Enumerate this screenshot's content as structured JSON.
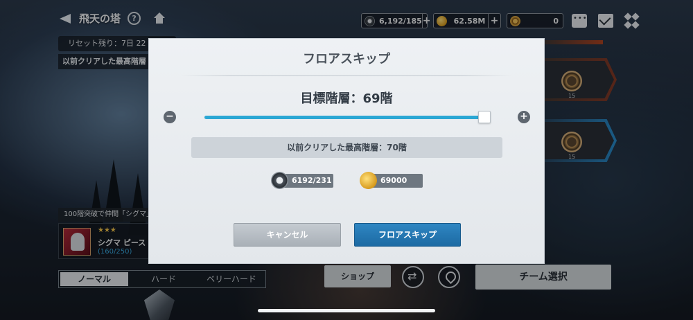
{
  "header": {
    "title": "飛天の塔",
    "help_glyph": "?"
  },
  "resources": {
    "stamina": {
      "icon": "gear-emblem-icon",
      "value": "6,192/185",
      "plus": "+"
    },
    "gold": {
      "icon": "gold-coin-icon",
      "value": "62.58M",
      "plus": "+"
    },
    "ticket": {
      "icon": "ticket-coin-icon",
      "value": "0"
    }
  },
  "left_panel": {
    "reset_text": "リセット残り：7日 22",
    "previous_clear_text": "以前クリアした最高階層",
    "companion_note": "100階突破で仲間「シグマ」",
    "character": {
      "stars": "★★★",
      "name": "シグマ ピース",
      "progress": "(160/250)"
    },
    "mode_tabs": [
      "ノーマル",
      "ハード",
      "ベリーハード"
    ]
  },
  "floor_list": {
    "items": [
      {
        "number": "15"
      },
      {
        "number": "15"
      }
    ]
  },
  "bottom_bar": {
    "shop": "ショップ",
    "team_select": "チーム選択"
  },
  "modal": {
    "title": "フロアスキップ",
    "target_floor": "目標階層：69階",
    "minus_glyph": "−",
    "plus_glyph": "+",
    "slider": {
      "value": 69,
      "max": 70
    },
    "previous_highest": "以前クリアした最高階層：70階",
    "cost": {
      "gear": {
        "icon": "gear-emblem-icon",
        "value": "6192/231"
      },
      "gold": {
        "icon": "gold-coin-icon",
        "value": "69000"
      }
    },
    "cancel_label": "キャンセル",
    "confirm_label": "フロアスキップ"
  },
  "colors": {
    "accent_blue": "#2ba7d4",
    "confirm_button": "#1c6aa3",
    "progress_text": "#39a9e0"
  }
}
